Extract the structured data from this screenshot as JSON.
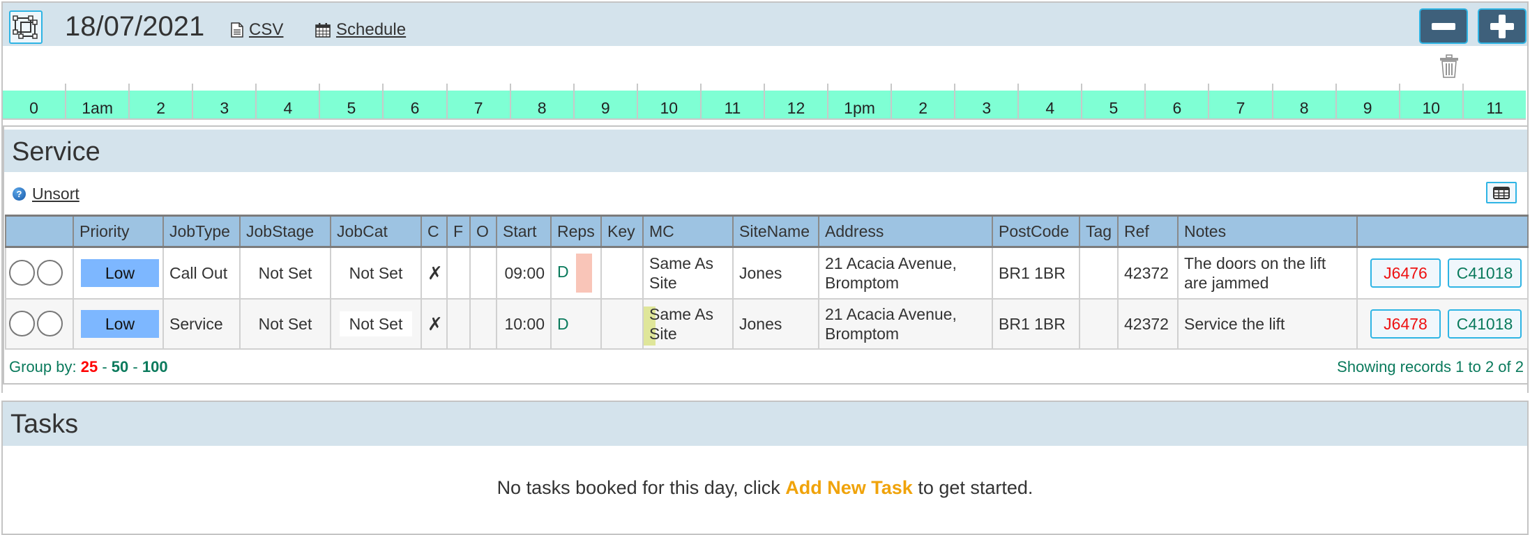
{
  "header": {
    "date": "18/07/2021",
    "csv_label": "CSV",
    "schedule_label": "Schedule",
    "zoom_out_icon": "minus-icon",
    "zoom_in_icon": "plus-icon",
    "delete_icon": "trash-icon"
  },
  "timeline": {
    "hours": [
      "0",
      "1am",
      "2",
      "3",
      "4",
      "5",
      "6",
      "7",
      "8",
      "9",
      "10",
      "11",
      "12",
      "1pm",
      "2",
      "3",
      "4",
      "5",
      "6",
      "7",
      "8",
      "9",
      "10",
      "11"
    ],
    "color": "#7fffd4"
  },
  "service": {
    "title": "Service",
    "unsort_label": "Unsort",
    "help_icon": "?",
    "columns": [
      "",
      "Priority",
      "JobType",
      "JobStage",
      "JobCat",
      "C",
      "F",
      "O",
      "Start",
      "Reps",
      "Key",
      "MC",
      "SiteName",
      "Address",
      "PostCode",
      "Tag",
      "Ref",
      "Notes",
      ""
    ],
    "rows": [
      {
        "priority": "Low",
        "job_type": "Call Out",
        "job_stage": "Not Set",
        "job_cat": "Not Set",
        "c": "✗",
        "f": "",
        "o": "",
        "start": "09:00",
        "reps": "D",
        "reps_flag_color": "#f9c5b8",
        "key": "",
        "mc": "Same As Site",
        "site_name": "Jones",
        "address": "21 Acacia Avenue, Bromptom",
        "post_code": "BR1 1BR",
        "tag": "",
        "ref": "42372",
        "notes": "The doors on the lift are jammed",
        "job_button": "J6476",
        "customer_button": "C41018"
      },
      {
        "priority": "Low",
        "job_type": "Service",
        "job_stage": "Not Set",
        "job_cat": "Not Set",
        "c": "✗",
        "f": "",
        "o": "",
        "start": "10:00",
        "reps": "D",
        "key": "",
        "mc": "Same As Site",
        "mc_flag_color": "#dfe69a",
        "site_name": "Jones",
        "address": "21 Acacia Avenue, Bromptom",
        "post_code": "BR1 1BR",
        "tag": "",
        "ref": "42372",
        "notes": "Service the lift",
        "job_button": "J6478",
        "customer_button": "C41018"
      }
    ],
    "group_by": {
      "label": "Group by:",
      "options": [
        "25",
        "50",
        "100"
      ],
      "separator": "-",
      "selected": "25"
    },
    "records_text": "Showing records 1 to 2 of 2"
  },
  "tasks": {
    "title": "Tasks",
    "empty_prefix": "No tasks booked for this day, click",
    "add_link": "Add New Task",
    "empty_suffix": "to get started."
  },
  "colors": {
    "header_bg": "#d4e3ec",
    "table_header_bg": "#9dc3e2",
    "priority_low": "#7db7ff",
    "job_ref": "#ee1111",
    "customer_ref": "#0a7a5c",
    "accent_border": "#2eb4e4",
    "add_task": "#f0a30a"
  }
}
